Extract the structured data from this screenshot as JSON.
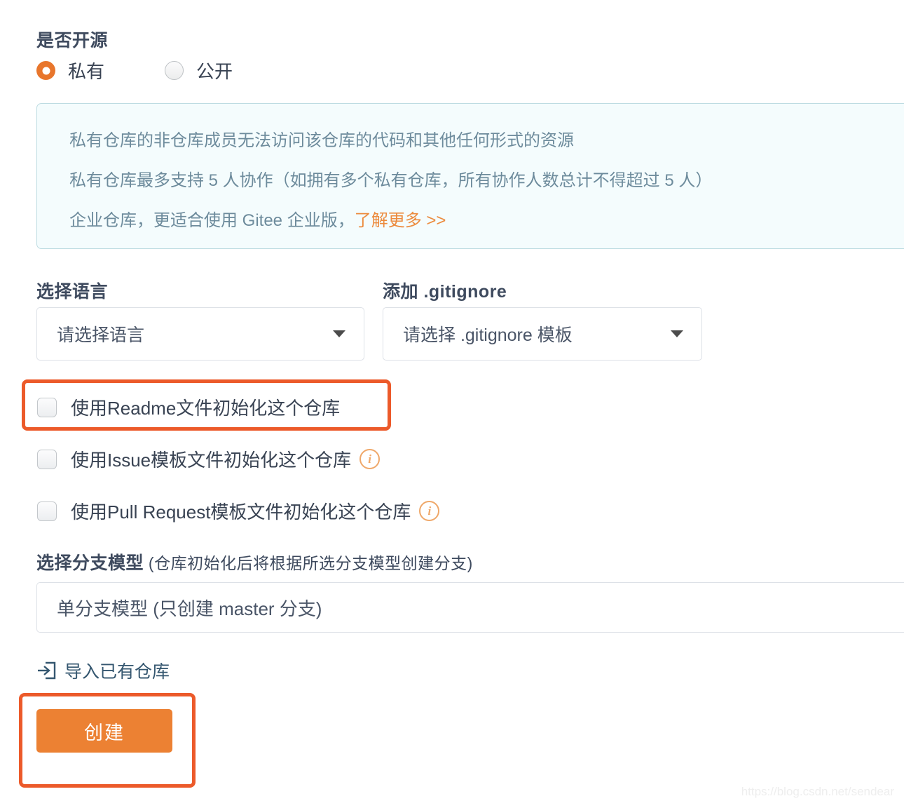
{
  "visibility": {
    "label": "是否开源",
    "options": [
      {
        "label": "私有",
        "selected": true
      },
      {
        "label": "公开",
        "selected": false
      }
    ]
  },
  "note": {
    "line1": "私有仓库的非仓库成员无法访问该仓库的代码和其他任何形式的资源",
    "line2": "私有仓库最多支持 5 人协作（如拥有多个私有仓库，所有协作人数总计不得超过 5 人）",
    "line3_prefix": "企业仓库，更适合使用 Gitee 企业版，",
    "line3_link": "了解更多 >>"
  },
  "language": {
    "label": "选择语言",
    "value": "请选择语言",
    "caret_icon": "chevron-down-icon"
  },
  "gitignore": {
    "label": "添加 .gitignore",
    "value": "请选择 .gitignore 模板",
    "caret_icon": "chevron-down-icon"
  },
  "checkboxes": [
    {
      "label": "使用Readme文件初始化这个仓库",
      "checked": false,
      "has_info": false
    },
    {
      "label": "使用Issue模板文件初始化这个仓库",
      "checked": false,
      "has_info": true,
      "info_icon": "info-circle-icon"
    },
    {
      "label": "使用Pull Request模板文件初始化这个仓库",
      "checked": false,
      "has_info": true,
      "info_icon": "info-circle-icon"
    }
  ],
  "branch_model": {
    "label_main": "选择分支模型",
    "label_sub": " (仓库初始化后将根据所选分支模型创建分支)",
    "value": "单分支模型 (只创建 master 分支)"
  },
  "import_link": {
    "label": "导入已有仓库",
    "icon": "import-repository-icon"
  },
  "create_button": {
    "label": "创建"
  },
  "watermark": {
    "text": "https://blog.csdn.net/sendear"
  },
  "colors": {
    "accent_orange": "#ec8133",
    "highlight_orange": "#ec5a2a",
    "radio_orange": "#e8762c",
    "note_bg": "#f4fcfd",
    "note_border": "#bedce2",
    "note_text": "#6d8b9c",
    "link_orange": "#ec8b3e",
    "heading_text": "#3e4a5e",
    "import_link_text": "#34566f"
  }
}
